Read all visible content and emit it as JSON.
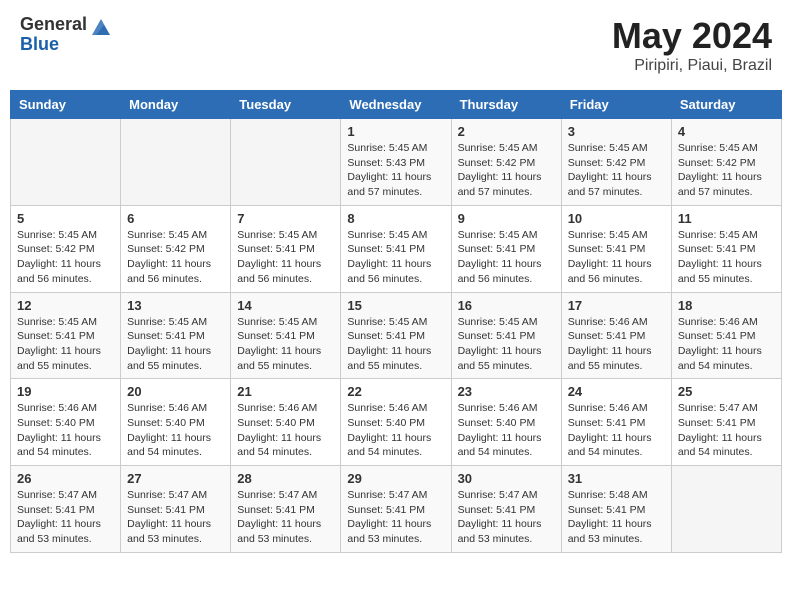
{
  "logo": {
    "general": "General",
    "blue": "Blue"
  },
  "title": "May 2024",
  "subtitle": "Piripiri, Piaui, Brazil",
  "weekdays": [
    "Sunday",
    "Monday",
    "Tuesday",
    "Wednesday",
    "Thursday",
    "Friday",
    "Saturday"
  ],
  "weeks": [
    [
      {
        "day": "",
        "info": ""
      },
      {
        "day": "",
        "info": ""
      },
      {
        "day": "",
        "info": ""
      },
      {
        "day": "1",
        "info": "Sunrise: 5:45 AM\nSunset: 5:43 PM\nDaylight: 11 hours\nand 57 minutes."
      },
      {
        "day": "2",
        "info": "Sunrise: 5:45 AM\nSunset: 5:42 PM\nDaylight: 11 hours\nand 57 minutes."
      },
      {
        "day": "3",
        "info": "Sunrise: 5:45 AM\nSunset: 5:42 PM\nDaylight: 11 hours\nand 57 minutes."
      },
      {
        "day": "4",
        "info": "Sunrise: 5:45 AM\nSunset: 5:42 PM\nDaylight: 11 hours\nand 57 minutes."
      }
    ],
    [
      {
        "day": "5",
        "info": "Sunrise: 5:45 AM\nSunset: 5:42 PM\nDaylight: 11 hours\nand 56 minutes."
      },
      {
        "day": "6",
        "info": "Sunrise: 5:45 AM\nSunset: 5:42 PM\nDaylight: 11 hours\nand 56 minutes."
      },
      {
        "day": "7",
        "info": "Sunrise: 5:45 AM\nSunset: 5:41 PM\nDaylight: 11 hours\nand 56 minutes."
      },
      {
        "day": "8",
        "info": "Sunrise: 5:45 AM\nSunset: 5:41 PM\nDaylight: 11 hours\nand 56 minutes."
      },
      {
        "day": "9",
        "info": "Sunrise: 5:45 AM\nSunset: 5:41 PM\nDaylight: 11 hours\nand 56 minutes."
      },
      {
        "day": "10",
        "info": "Sunrise: 5:45 AM\nSunset: 5:41 PM\nDaylight: 11 hours\nand 56 minutes."
      },
      {
        "day": "11",
        "info": "Sunrise: 5:45 AM\nSunset: 5:41 PM\nDaylight: 11 hours\nand 55 minutes."
      }
    ],
    [
      {
        "day": "12",
        "info": "Sunrise: 5:45 AM\nSunset: 5:41 PM\nDaylight: 11 hours\nand 55 minutes."
      },
      {
        "day": "13",
        "info": "Sunrise: 5:45 AM\nSunset: 5:41 PM\nDaylight: 11 hours\nand 55 minutes."
      },
      {
        "day": "14",
        "info": "Sunrise: 5:45 AM\nSunset: 5:41 PM\nDaylight: 11 hours\nand 55 minutes."
      },
      {
        "day": "15",
        "info": "Sunrise: 5:45 AM\nSunset: 5:41 PM\nDaylight: 11 hours\nand 55 minutes."
      },
      {
        "day": "16",
        "info": "Sunrise: 5:45 AM\nSunset: 5:41 PM\nDaylight: 11 hours\nand 55 minutes."
      },
      {
        "day": "17",
        "info": "Sunrise: 5:46 AM\nSunset: 5:41 PM\nDaylight: 11 hours\nand 55 minutes."
      },
      {
        "day": "18",
        "info": "Sunrise: 5:46 AM\nSunset: 5:41 PM\nDaylight: 11 hours\nand 54 minutes."
      }
    ],
    [
      {
        "day": "19",
        "info": "Sunrise: 5:46 AM\nSunset: 5:40 PM\nDaylight: 11 hours\nand 54 minutes."
      },
      {
        "day": "20",
        "info": "Sunrise: 5:46 AM\nSunset: 5:40 PM\nDaylight: 11 hours\nand 54 minutes."
      },
      {
        "day": "21",
        "info": "Sunrise: 5:46 AM\nSunset: 5:40 PM\nDaylight: 11 hours\nand 54 minutes."
      },
      {
        "day": "22",
        "info": "Sunrise: 5:46 AM\nSunset: 5:40 PM\nDaylight: 11 hours\nand 54 minutes."
      },
      {
        "day": "23",
        "info": "Sunrise: 5:46 AM\nSunset: 5:40 PM\nDaylight: 11 hours\nand 54 minutes."
      },
      {
        "day": "24",
        "info": "Sunrise: 5:46 AM\nSunset: 5:41 PM\nDaylight: 11 hours\nand 54 minutes."
      },
      {
        "day": "25",
        "info": "Sunrise: 5:47 AM\nSunset: 5:41 PM\nDaylight: 11 hours\nand 54 minutes."
      }
    ],
    [
      {
        "day": "26",
        "info": "Sunrise: 5:47 AM\nSunset: 5:41 PM\nDaylight: 11 hours\nand 53 minutes."
      },
      {
        "day": "27",
        "info": "Sunrise: 5:47 AM\nSunset: 5:41 PM\nDaylight: 11 hours\nand 53 minutes."
      },
      {
        "day": "28",
        "info": "Sunrise: 5:47 AM\nSunset: 5:41 PM\nDaylight: 11 hours\nand 53 minutes."
      },
      {
        "day": "29",
        "info": "Sunrise: 5:47 AM\nSunset: 5:41 PM\nDaylight: 11 hours\nand 53 minutes."
      },
      {
        "day": "30",
        "info": "Sunrise: 5:47 AM\nSunset: 5:41 PM\nDaylight: 11 hours\nand 53 minutes."
      },
      {
        "day": "31",
        "info": "Sunrise: 5:48 AM\nSunset: 5:41 PM\nDaylight: 11 hours\nand 53 minutes."
      },
      {
        "day": "",
        "info": ""
      }
    ]
  ]
}
